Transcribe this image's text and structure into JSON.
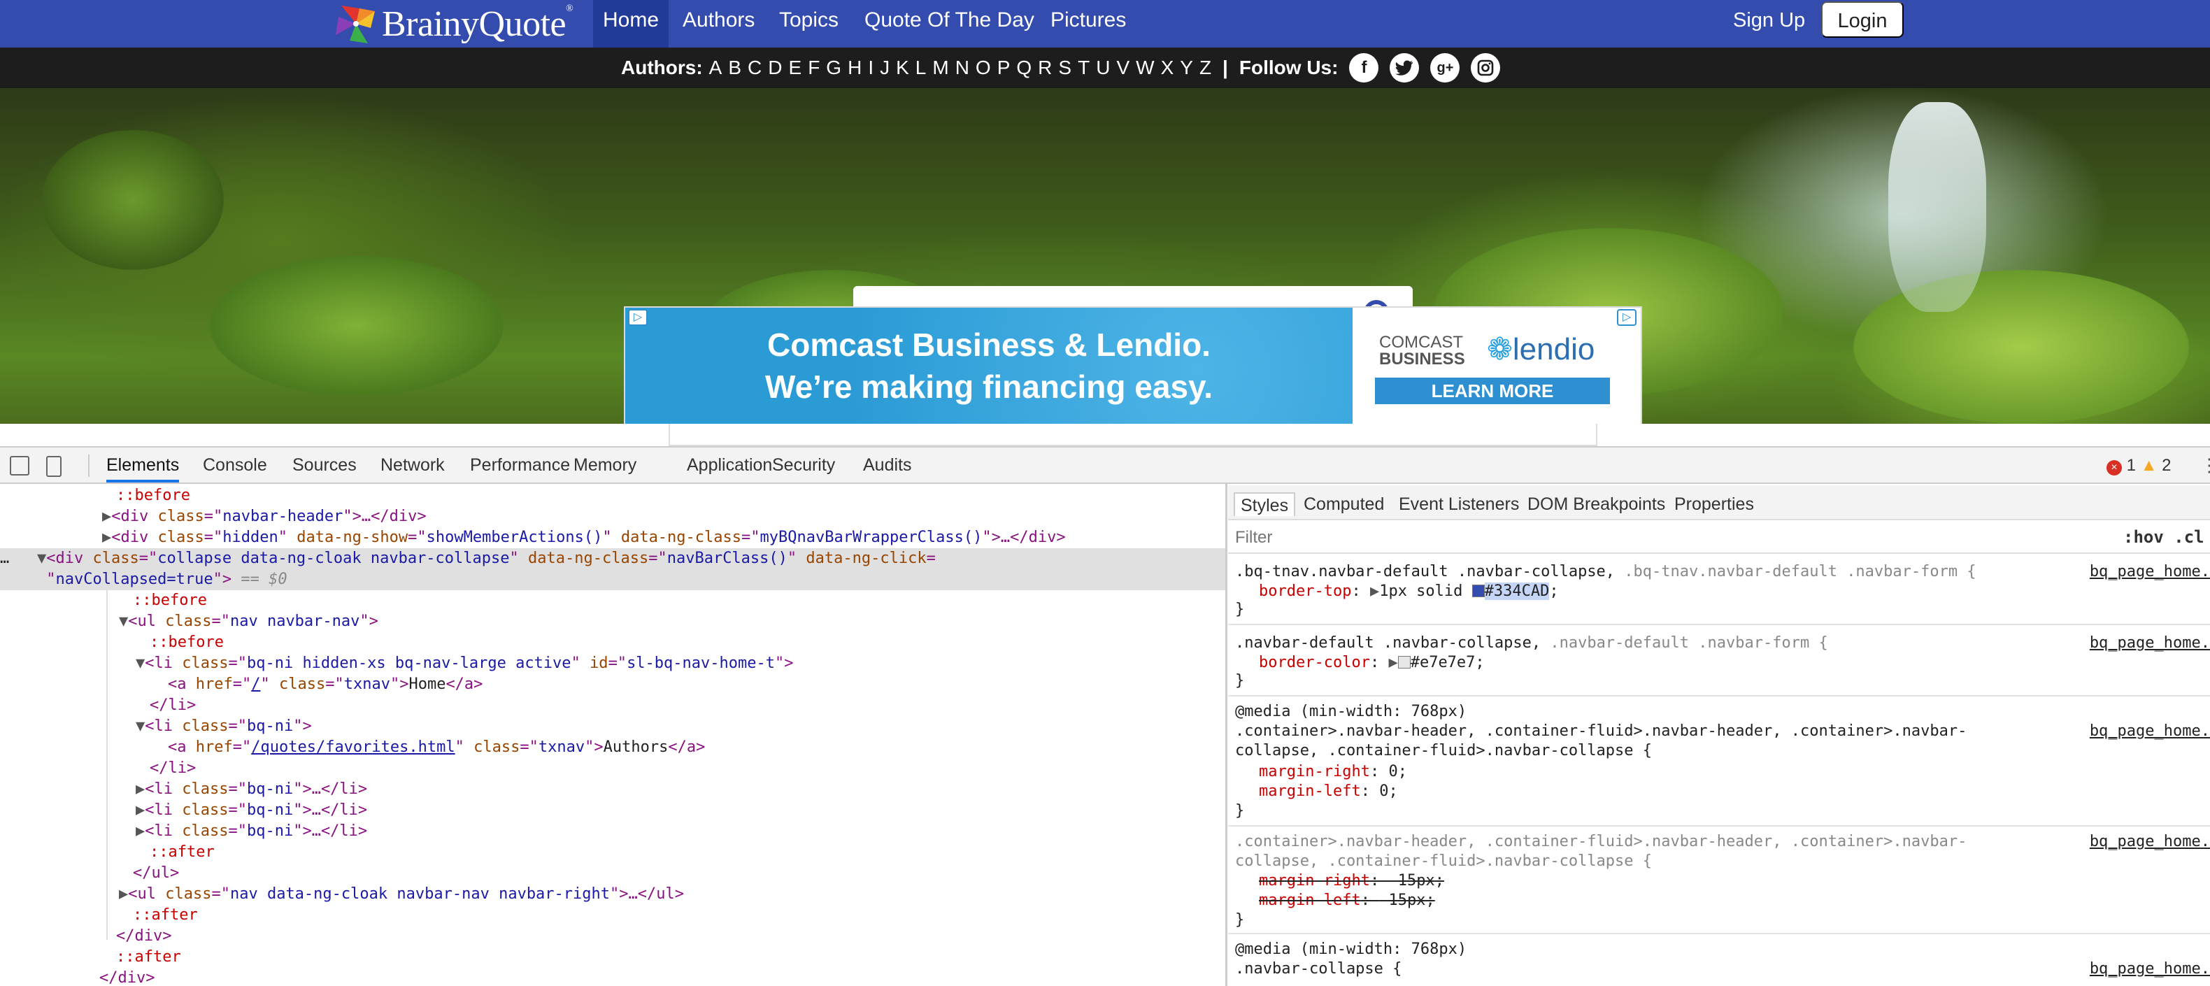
{
  "site": {
    "logo_text": "BrainyQuote",
    "logo_mark": "®",
    "nav": [
      {
        "label": "Home"
      },
      {
        "label": "Authors"
      },
      {
        "label": "Topics"
      },
      {
        "label": "Quote Of The Day"
      },
      {
        "label": "Pictures"
      }
    ],
    "signup_label": "Sign Up",
    "login_label": "Login",
    "authors_label": "Authors:",
    "letters": [
      "A",
      "B",
      "C",
      "D",
      "E",
      "F",
      "G",
      "H",
      "I",
      "J",
      "K",
      "L",
      "M",
      "N",
      "O",
      "P",
      "Q",
      "R",
      "S",
      "T",
      "U",
      "V",
      "W",
      "X",
      "Y",
      "Z"
    ],
    "follow_label": "Follow Us:",
    "social_icons": [
      "facebook-icon",
      "twitter-icon",
      "google-plus-icon",
      "instagram-icon"
    ],
    "search": {
      "placeholder": "search"
    },
    "ad": {
      "line1": "Comcast Business & Lendio.",
      "line2": "We’re making financing easy.",
      "comcast_line1": "COMCAST",
      "comcast_line2": "BUSINESS",
      "lendio": "lendio",
      "cta": "LEARN MORE"
    },
    "colors": {
      "nav_bg": "#334cad",
      "authors_bar_bg": "#1d1d1d",
      "ad_bg": "#2b9bd6"
    }
  },
  "devtools": {
    "tabs": [
      "Elements",
      "Console",
      "Sources",
      "Network",
      "Performance",
      "Memory",
      "Application",
      "Security",
      "Audits"
    ],
    "active_tab": "Elements",
    "errors": "1",
    "warnings": "2",
    "dom": {
      "l1": "::before",
      "l2_tag": "<div ",
      "l2_attr": "class",
      "l2_val": "navbar-header",
      "l2_tail": ">…</div>",
      "l3_attr1": "class",
      "l3_val1": "hidden",
      "l3_attr2": "data-ng-show",
      "l3_val2": "showMemberActions()",
      "l3_attr3": "data-ng-class",
      "l3_val3": "myBQnavBarWrapperClass()",
      "l3_tail": ">…</div>",
      "l4_attr1": "class",
      "l4_val1": "collapse data-ng-cloak navbar-collapse",
      "l4_attr2": "data-ng-class",
      "l4_val2": "navBarClass()",
      "l4_attr3": "data-ng-click",
      "l5_val": "navCollapsed=true",
      "l5_eq": "== $0",
      "l6": "::before",
      "l7_attr": "class",
      "l7_val": "nav navbar-nav",
      "l8": "::before",
      "l9_attr1": "class",
      "l9_val1": "bq-ni hidden-xs bq-nav-large active",
      "l9_attr2": "id",
      "l9_val2": "sl-bq-nav-home-t",
      "l10_href": "/",
      "l10_class": "txnav",
      "l10_text": "Home",
      "l11": "</li>",
      "l12_attr": "class",
      "l12_val": "bq-ni",
      "l13_href": "/quotes/favorites.html",
      "l13_class": "txnav",
      "l13_text": "Authors",
      "l14": "</li>",
      "l15_val": "bq-ni",
      "l16_val": "bq-ni",
      "l17_val": "bq-ni",
      "l18": "::after",
      "l19": "</ul>",
      "l20_attr": "class",
      "l20_val": "nav data-ng-cloak navbar-nav navbar-right",
      "l21": "::after",
      "l22": "</div>",
      "l23": "::after",
      "l24": "</div>"
    },
    "styles": {
      "tabs": [
        "Styles",
        "Computed",
        "Event Listeners",
        "DOM Breakpoints",
        "Properties"
      ],
      "filter_placeholder": "Filter",
      "hov": ":hov .cl",
      "source": "bq_page_home.",
      "r1_sel_a": ".bq-tnav.navbar-default .navbar-collapse,",
      "r1_sel_b": " .bq-tnav.navbar-default .navbar-form {",
      "r1_prop": "border-top",
      "r1_val1": "1px solid ",
      "r1_val2": "#334CAD",
      "r1_swatch": "#334cad",
      "r2_sel_a": ".navbar-default .navbar-collapse,",
      "r2_sel_b": " .navbar-default .navbar-form {",
      "r2_prop": "border-color",
      "r2_val": "#e7e7e7",
      "r2_swatch": "#e7e7e7",
      "r3_media": "@media (min-width: 768px)",
      "r3_sel1": ".container>.navbar-header, .container-fluid>.navbar-header, .container>.navbar-",
      "r3_sel2": "collapse, .container-fluid>.navbar-collapse {",
      "r3_p1": "margin-right",
      "r3_v1": "0",
      "r3_p2": "margin-left",
      "r3_v2": "0",
      "r4_sel1": ".container>.navbar-header, .container-fluid>.navbar-header, .container>.navbar-",
      "r4_sel2": "collapse, .container-fluid>.navbar-collapse {",
      "r4_p1": "margin-right",
      "r4_v1": "-15px",
      "r4_p2": "margin-left",
      "r4_v2": "-15px",
      "r5_media": "@media (min-width: 768px)",
      "r5_sel": ".navbar-collapse {",
      "brace_close": "}"
    }
  }
}
